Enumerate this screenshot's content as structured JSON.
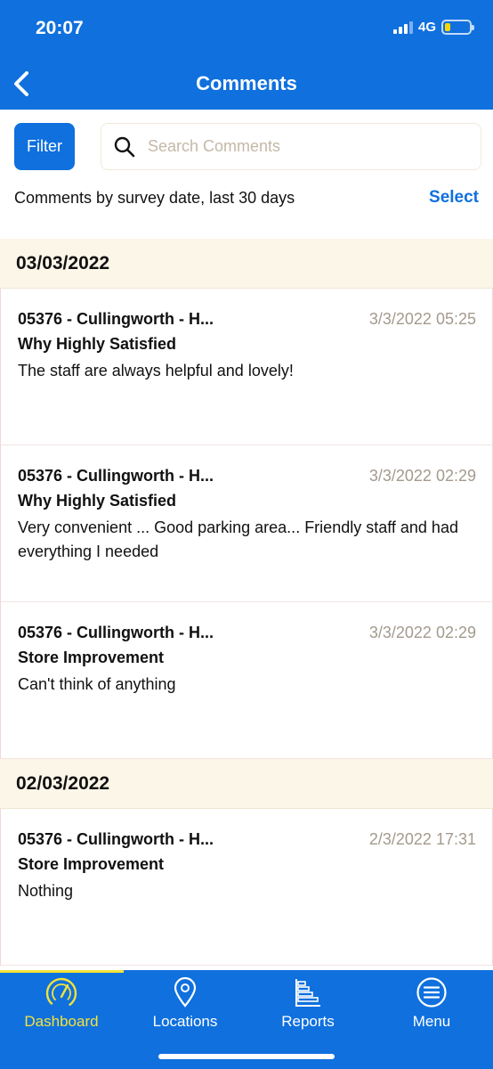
{
  "status": {
    "time": "20:07",
    "network": "4G"
  },
  "header": {
    "title": "Comments"
  },
  "toolbar": {
    "filter_label": "Filter",
    "search_placeholder": "Search Comments",
    "range_text": "Comments by survey date, last 30 days",
    "select_label": "Select"
  },
  "groups": [
    {
      "date": "03/03/2022",
      "comments": [
        {
          "store": "05376 - Cullingworth - H...",
          "time": "3/3/2022 05:25",
          "question": "Why Highly Satisfied",
          "text": "The staff are always helpful and lovely!"
        },
        {
          "store": "05376 - Cullingworth - H...",
          "time": "3/3/2022 02:29",
          "question": "Why Highly Satisfied",
          "text": "Very convenient ... Good parking area... Friendly staff and had everything I needed"
        },
        {
          "store": "05376 - Cullingworth - H...",
          "time": "3/3/2022 02:29",
          "question": "Store Improvement",
          "text": "Can't think of anything"
        }
      ]
    },
    {
      "date": "02/03/2022",
      "comments": [
        {
          "store": "05376 - Cullingworth - H...",
          "time": "2/3/2022 17:31",
          "question": "Store Improvement",
          "text": "Nothing"
        }
      ]
    }
  ],
  "tabs": [
    {
      "label": "Dashboard",
      "icon": "dashboard-gauge-icon",
      "active": true
    },
    {
      "label": "Locations",
      "icon": "location-pin-icon",
      "active": false
    },
    {
      "label": "Reports",
      "icon": "reports-chart-icon",
      "active": false
    },
    {
      "label": "Menu",
      "icon": "menu-icon",
      "active": false
    }
  ],
  "colors": {
    "primary": "#0f70de",
    "accent": "#f3e23a",
    "date_header_bg": "#fbf6e8",
    "timestamp": "#a39a8d"
  }
}
